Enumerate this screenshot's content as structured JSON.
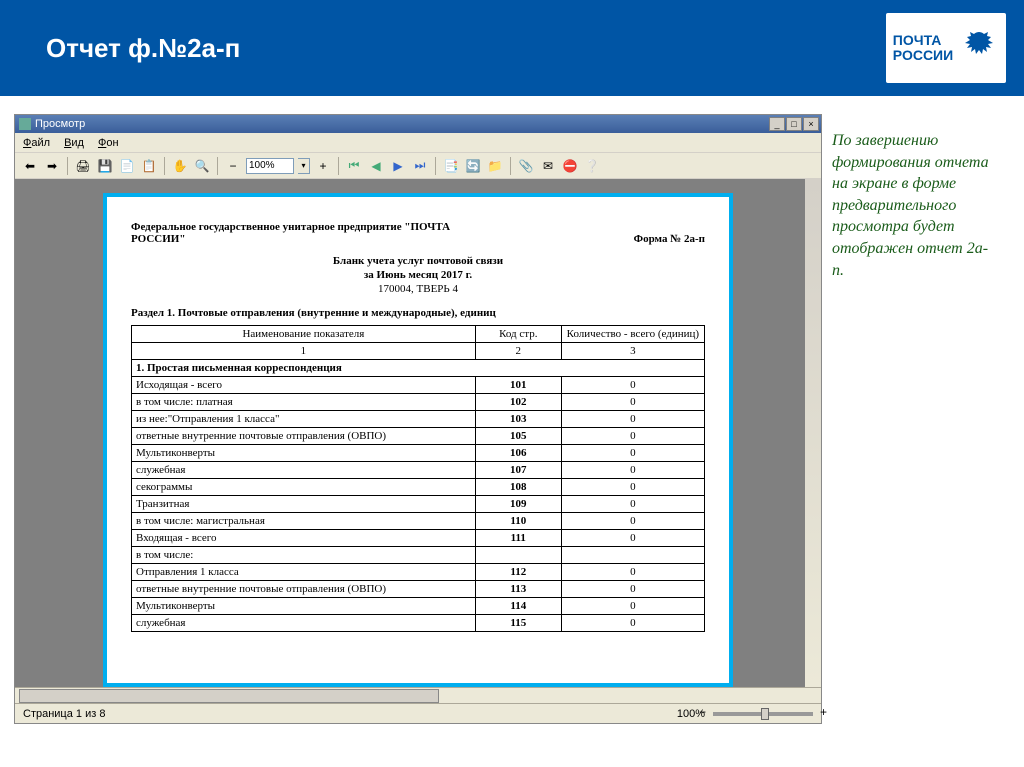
{
  "slide": {
    "title": "Отчет ф.№2а-п"
  },
  "logo": {
    "line1": "ПОЧТА",
    "line2": "РОССИИ"
  },
  "window": {
    "title": "Просмотр",
    "menu": [
      "Файл",
      "Вид",
      "Фон"
    ],
    "zoom": "100%"
  },
  "doc": {
    "org": "Федеральное государственное унитарное предприятие \"ПОЧТА РОССИИ\"",
    "form_no": "Форма № 2а-п",
    "title": "Бланк учета услуг почтовой связи",
    "period": "за Июнь месяц 2017 г.",
    "place": "170004, ТВЕРЬ 4",
    "section": "Раздел 1. Почтовые отправления (внутренние и международные), единиц",
    "cols": {
      "name": "Наименование показателя",
      "code": "Код стр.",
      "qty": "Количество - всего (единиц)",
      "c1": "1",
      "c2": "2",
      "c3": "3"
    },
    "group1": "1. Простая письменная корреспонденция",
    "rows": [
      {
        "label": "Исходящая - всего",
        "indent": 1,
        "code": "101",
        "qty": "0"
      },
      {
        "label": "в том числе: платная",
        "indent": 2,
        "code": "102",
        "qty": "0"
      },
      {
        "label": "из нее:\"Отправления 1 класса\"",
        "indent": 3,
        "code": "103",
        "qty": "0"
      },
      {
        "label": "ответные внутренние почтовые отправления (ОВПО)",
        "indent": 3,
        "code": "105",
        "qty": "0"
      },
      {
        "label": "Мультиконверты",
        "indent": 3,
        "code": "106",
        "qty": "0"
      },
      {
        "label": "служебная",
        "indent": 2,
        "code": "107",
        "qty": "0"
      },
      {
        "label": "секограммы",
        "indent": 2,
        "code": "108",
        "qty": "0"
      },
      {
        "label": "Транзитная",
        "indent": 1,
        "code": "109",
        "qty": "0"
      },
      {
        "label": "в том числе: магистральная",
        "indent": 2,
        "code": "110",
        "qty": "0"
      },
      {
        "label": "Входящая - всего",
        "indent": 1,
        "code": "111",
        "qty": "0"
      },
      {
        "label": "в том числе:",
        "indent": 2,
        "code": "",
        "qty": ""
      },
      {
        "label": "Отправления 1 класса",
        "indent": 2,
        "code": "112",
        "qty": "0"
      },
      {
        "label": "ответные внутренние почтовые отправления (ОВПО)",
        "indent": 2,
        "code": "113",
        "qty": "0"
      },
      {
        "label": "Мультиконверты",
        "indent": 2,
        "code": "114",
        "qty": "0"
      },
      {
        "label": "служебная",
        "indent": 2,
        "code": "115",
        "qty": "0"
      }
    ]
  },
  "status": {
    "page": "Страница 1 из 8",
    "zoom": "100%"
  },
  "side": "По завершению формирования отчета на экране в форме предварительного просмотра будет отображен отчет 2а-п."
}
